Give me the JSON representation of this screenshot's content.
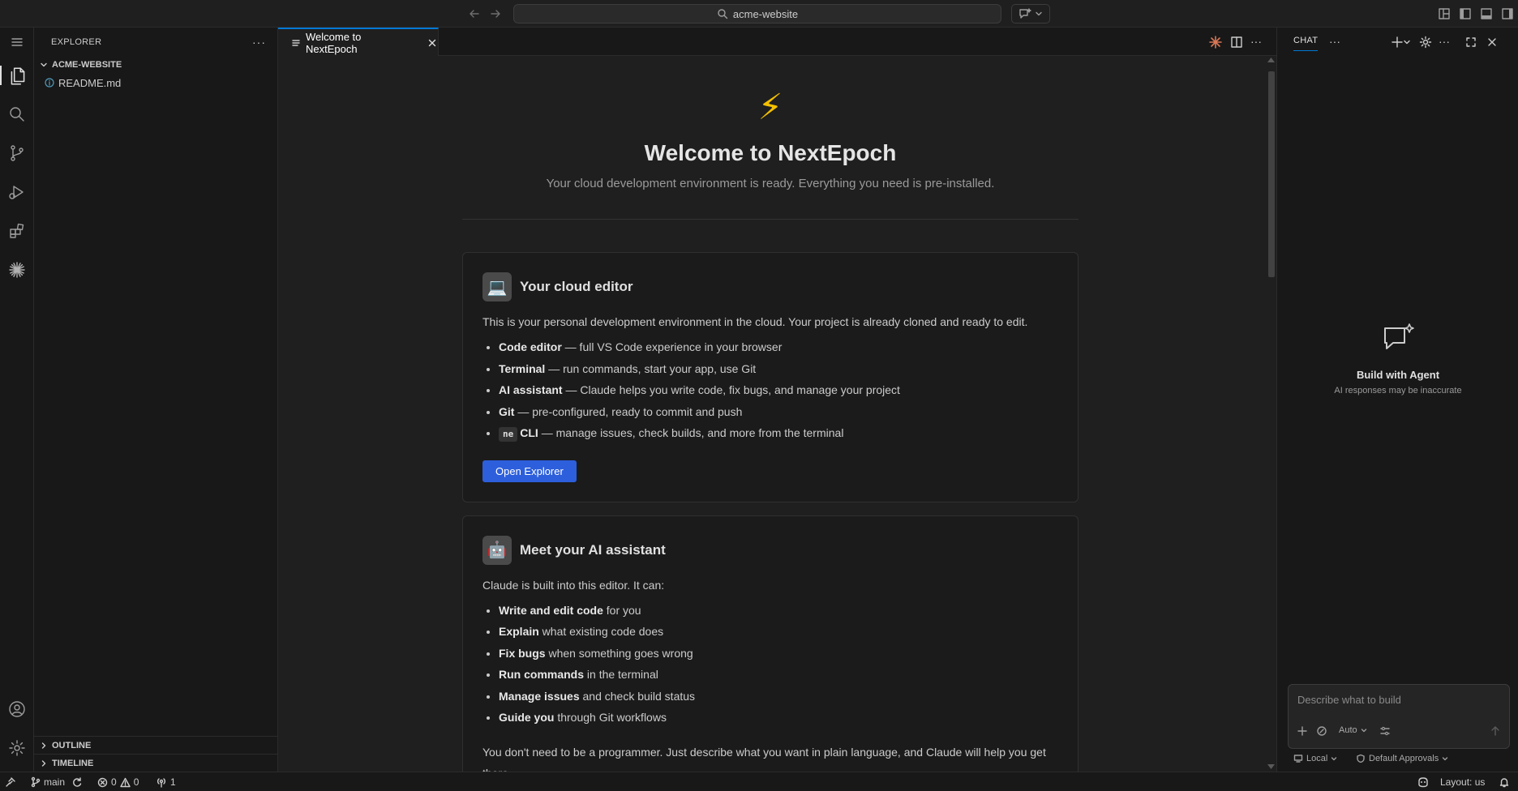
{
  "titlebar": {
    "search_text": "acme-website"
  },
  "sidebar": {
    "title": "EXPLORER",
    "root_folder": "ACME-WEBSITE",
    "files": [
      {
        "name": "README.md"
      }
    ],
    "outline_label": "OUTLINE",
    "timeline_label": "TIMELINE"
  },
  "editor": {
    "tab_label": "Welcome to NextEpoch",
    "welcome": {
      "hero_icon": "⚡",
      "title": "Welcome to NextEpoch",
      "subtitle": "Your cloud development environment is ready. Everything you need is pre-installed.",
      "cards": [
        {
          "emoji": "💻",
          "title": "Your cloud editor",
          "intro": "This is your personal development environment in the cloud. Your project is already cloned and ready to edit.",
          "items": [
            {
              "bold": "Code editor",
              "text": " — full VS Code experience in your browser"
            },
            {
              "bold": "Terminal",
              "text": " — run commands, start your app, use Git"
            },
            {
              "bold": "AI assistant",
              "text": " — Claude helps you write code, fix bugs, and manage your project"
            },
            {
              "bold": "Git",
              "text": " — pre-configured, ready to commit and push"
            },
            {
              "code": "ne",
              "bold": "CLI",
              "text": " — manage issues, check builds, and more from the terminal"
            }
          ],
          "button": "Open Explorer"
        },
        {
          "emoji": "🤖",
          "title": "Meet your AI assistant",
          "intro": "Claude is built into this editor. It can:",
          "items": [
            {
              "bold": "Write and edit code",
              "text": " for you"
            },
            {
              "bold": "Explain",
              "text": " what existing code does"
            },
            {
              "bold": "Fix bugs",
              "text": " when something goes wrong"
            },
            {
              "bold": "Run commands",
              "text": " in the terminal"
            },
            {
              "bold": "Manage issues",
              "text": " and check build status"
            },
            {
              "bold": "Guide you",
              "text": " through Git workflows"
            }
          ],
          "outro": "You don't need to be a programmer. Just describe what you want in plain language, and Claude will help you get there."
        }
      ]
    }
  },
  "chat": {
    "tab_label": "CHAT",
    "empty_title": "Build with Agent",
    "empty_subtitle": "AI responses may be inaccurate",
    "input_placeholder": "Describe what to build",
    "mode_label": "Auto",
    "location_label": "Local",
    "approvals_label": "Default Approvals"
  },
  "statusbar": {
    "branch": "main",
    "errors": "0",
    "warnings": "0",
    "ports": "1",
    "layout": "Layout: us"
  },
  "colors": {
    "accent": "#0078d4",
    "button": "#2d5fdc",
    "background": "#1f1f1f"
  }
}
